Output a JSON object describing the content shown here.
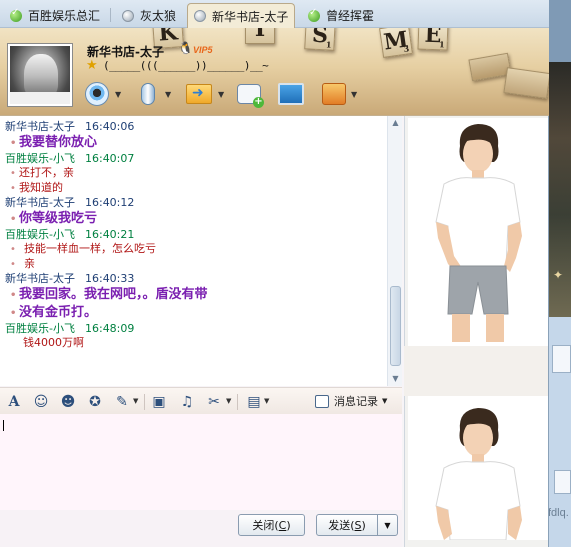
{
  "tabs": [
    {
      "label": "百胜娱乐总汇",
      "status": "online",
      "active": false
    },
    {
      "label": "灰太狼",
      "status": "offline",
      "active": false
    },
    {
      "label": "新华书店-太子",
      "status": "offline",
      "active": true
    },
    {
      "label": "曾经挥霍",
      "status": "online",
      "active": false
    }
  ],
  "header": {
    "contact_name": "新华书店-太子",
    "vip_label": "VIP5",
    "signature": "(_____(((______))______)__~",
    "banner_tiles": [
      {
        "letter": "K",
        "score": ""
      },
      {
        "letter": "I",
        "score": ""
      },
      {
        "letter": "S",
        "score": "1"
      },
      {
        "letter": "S",
        "score": "1"
      },
      {
        "letter": "M",
        "score": "3"
      },
      {
        "letter": "E",
        "score": "1"
      }
    ],
    "toolbar_icons": [
      "webcam-icon",
      "microphone-icon",
      "send-file-icon",
      "group-chat-icon",
      "remote-assistance-icon",
      "app-box-icon"
    ]
  },
  "messages": [
    {
      "sender": "新华书店-太子",
      "time": "16:40:06",
      "side": "me",
      "lines": [
        {
          "text": "我要替你放心",
          "style": "big"
        }
      ]
    },
    {
      "sender": "百胜娱乐-小飞",
      "time": "16:40:07",
      "side": "them",
      "lines": [
        {
          "text": "还打不，亲",
          "style": "small"
        },
        {
          "text": "我知道的",
          "style": "small"
        }
      ]
    },
    {
      "sender": "新华书店-太子",
      "time": "16:40:12",
      "side": "me",
      "lines": [
        {
          "text": "你等级我吃亏",
          "style": "big"
        }
      ]
    },
    {
      "sender": "百胜娱乐-小飞",
      "time": "16:40:21",
      "side": "them",
      "lines": [
        {
          "text": "技能一样血一样，怎么吃亏",
          "style": "small"
        },
        {
          "text": "亲",
          "style": "small"
        }
      ]
    },
    {
      "sender": "新华书店-太子",
      "time": "16:40:33",
      "side": "me",
      "lines": [
        {
          "text": "我要回家。我在网吧，。盾没有带",
          "style": "big"
        },
        {
          "text": "没有金币打。",
          "style": "big"
        }
      ]
    },
    {
      "sender": "百胜娱乐-小飞",
      "time": "16:48:09",
      "side": "them",
      "lines": [
        {
          "text": "钱4000万啊",
          "style": "plain"
        }
      ]
    }
  ],
  "format_toolbar": {
    "icons": [
      "font-icon",
      "emoticon-icon",
      "face-icon",
      "magic-face-icon",
      "handwriting-icon",
      "image-icon",
      "music-icon",
      "screenshot-icon",
      "more-apps-icon"
    ],
    "history_label": "消息记录"
  },
  "buttons": {
    "close": "关闭(C)",
    "close_text": "关闭(",
    "close_key": "C",
    "send_text": "发送(",
    "send_key": "S",
    "paren": ")"
  },
  "background_window": {
    "fragment_text": "fdlq."
  }
}
